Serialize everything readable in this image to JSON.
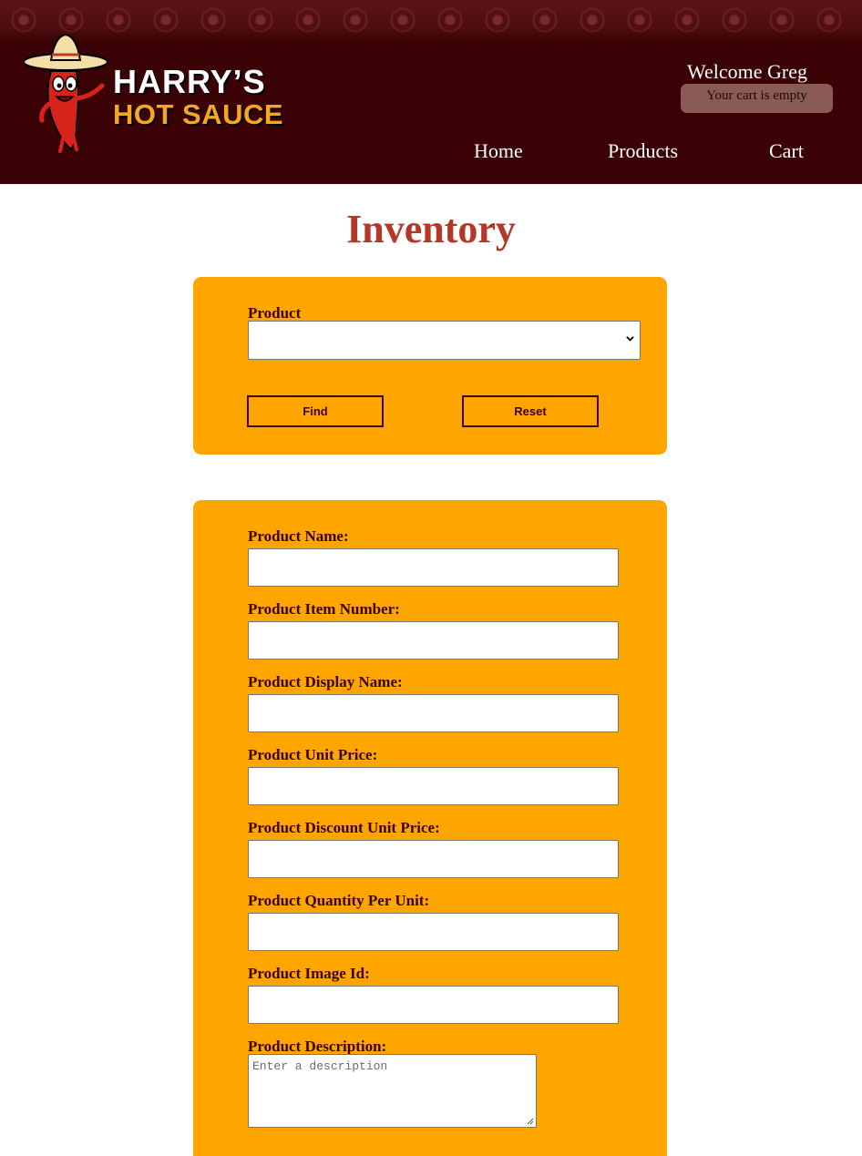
{
  "header": {
    "logo": {
      "line1": "HARRY’S",
      "line2": "HOT SAUCE"
    },
    "welcome": "Welcome Greg",
    "cart_status": "Your cart is empty",
    "nav": {
      "home": "Home",
      "products": "Products",
      "cart": "Cart"
    }
  },
  "main": {
    "title": "Inventory",
    "find": {
      "product_label": "Product",
      "product_value": "",
      "find_label": "Find",
      "reset_label": "Reset"
    },
    "form": {
      "fields": [
        {
          "label": "Product Name:",
          "value": ""
        },
        {
          "label": "Product Item Number:",
          "value": ""
        },
        {
          "label": "Product Display Name:",
          "value": ""
        },
        {
          "label": "Product Unit Price:",
          "value": ""
        },
        {
          "label": "Product Discount Unit Price:",
          "value": ""
        },
        {
          "label": "Product Quantity Per Unit:",
          "value": ""
        },
        {
          "label": "Product Image Id:",
          "value": ""
        }
      ],
      "description": {
        "label": "Product Description:",
        "placeholder": "Enter a description",
        "value": ""
      }
    }
  },
  "colors": {
    "header_bg": "#3a0204",
    "accent_orange": "#ffa500",
    "title_red": "#b5372a",
    "logo_yellow": "#f5a623"
  },
  "icons": {
    "mascot": "chili-pepper-mascot-icon",
    "select_chevron": "chevron-down-icon"
  }
}
